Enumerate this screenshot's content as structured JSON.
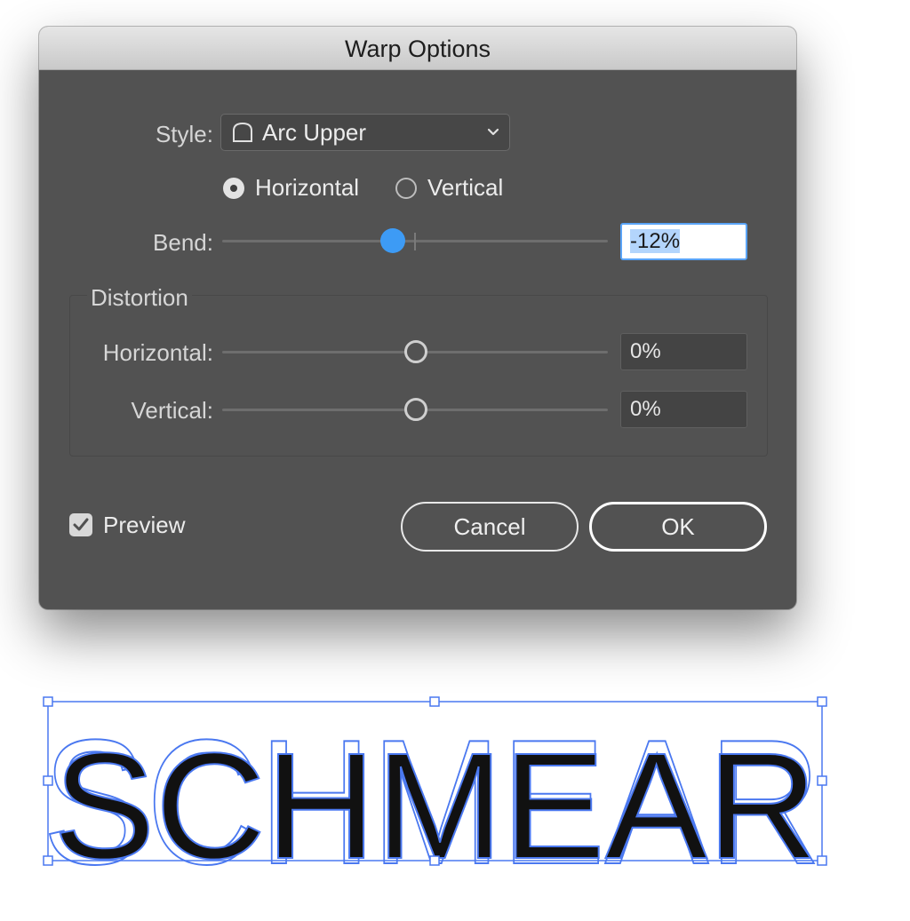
{
  "dialog": {
    "title": "Warp Options",
    "style": {
      "label": "Style:",
      "value": "Arc Upper",
      "icon": "arc-upper-icon"
    },
    "orientation": {
      "options": [
        "Horizontal",
        "Vertical"
      ],
      "selected": "Horizontal"
    },
    "bend": {
      "label": "Bend:",
      "value": "-12%",
      "percent": -12
    },
    "distortion": {
      "title": "Distortion",
      "horizontal": {
        "label": "Horizontal:",
        "value": "0%",
        "percent": 0
      },
      "vertical": {
        "label": "Vertical:",
        "value": "0%",
        "percent": 0
      }
    },
    "preview": {
      "label": "Preview",
      "checked": true
    },
    "buttons": {
      "cancel": "Cancel",
      "ok": "OK"
    }
  },
  "artwork": {
    "text": "SCHMEAR"
  },
  "colors": {
    "accent": "#3d9bf5",
    "selection": "#4a78f0",
    "dialog_bg": "#525252"
  }
}
